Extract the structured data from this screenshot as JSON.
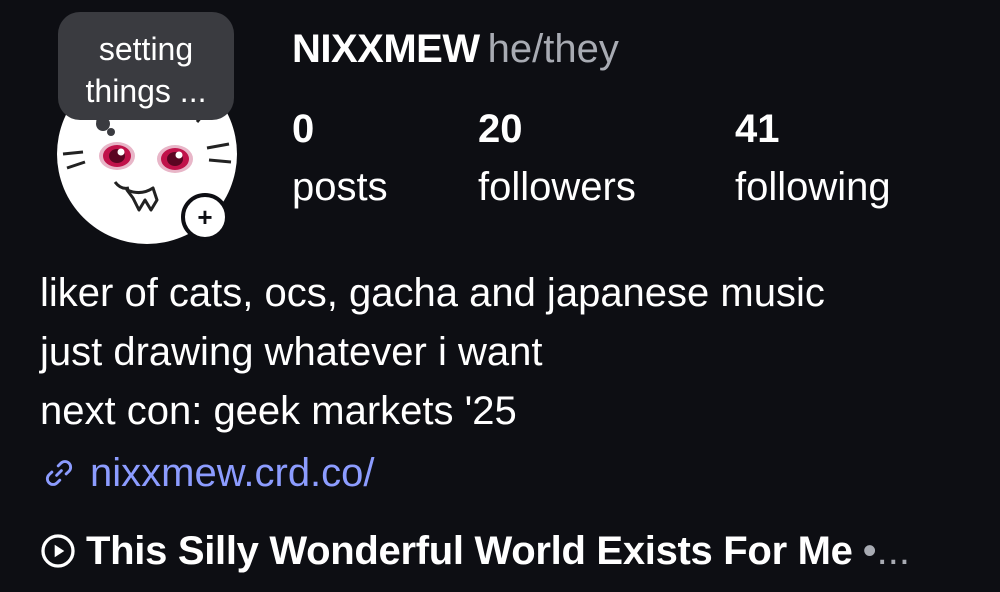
{
  "profile": {
    "username": "NIXXMEW",
    "pronouns": "he/they",
    "note": {
      "line1": "setting",
      "line2": "things ..."
    },
    "avatar": {
      "icon": "cat-face-avatar",
      "add_button_label": "+"
    }
  },
  "stats": [
    {
      "value": "0",
      "label": "posts"
    },
    {
      "value": "20",
      "label": "followers"
    },
    {
      "value": "41",
      "label": "following"
    }
  ],
  "bio": {
    "lines": [
      "liker of cats, ocs, gacha and japanese music",
      "just drawing whatever i want",
      "next con: geek markets '25"
    ],
    "link": {
      "icon": "link-icon",
      "text": "nixxmew.crd.co/"
    }
  },
  "music": {
    "icon": "play-circle-icon",
    "title": "This Silly Wonderful World Exists For Me",
    "more": "•..."
  },
  "colors": {
    "background": "#0d0e13",
    "text": "#ffffff",
    "muted": "#a8abb3",
    "link": "#8c9cff",
    "bubble": "#3a3b40"
  }
}
